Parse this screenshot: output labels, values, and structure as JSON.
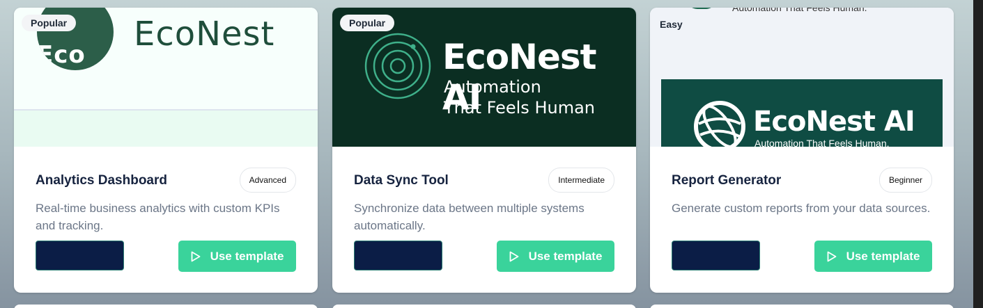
{
  "cards": [
    {
      "badge": "Popular",
      "thumb": {
        "brand": "EcoNest",
        "circle_text": "Eco"
      },
      "title": "Analytics Dashboard",
      "level": "Advanced",
      "description": "Real-time business analytics with custom KPIs and tracking.",
      "cta": "Use template"
    },
    {
      "badge": "Popular",
      "thumb": {
        "brand": "EcoNest AI",
        "tagline_1": "Automation",
        "tagline_2": "That Feels Human"
      },
      "title": "Data Sync Tool",
      "level": "Intermediate",
      "description": "Synchronize data between multiple systems automatically.",
      "cta": "Use template"
    },
    {
      "badge": "Easy",
      "thumb": {
        "top_text": "Automation That Feels Human.",
        "brand": "EcoNest AI",
        "subtag": "Automation That Feels Human."
      },
      "title": "Report Generator",
      "level": "Beginner",
      "description": "Generate custom reports from your data sources.",
      "cta": "Use template"
    }
  ],
  "colors": {
    "accent_green": "#3ad39b",
    "dark_button": "#0b1d46",
    "title_text": "#16233f",
    "description_text": "#6b7687"
  },
  "icons": {
    "cta_icon": "play-icon"
  }
}
